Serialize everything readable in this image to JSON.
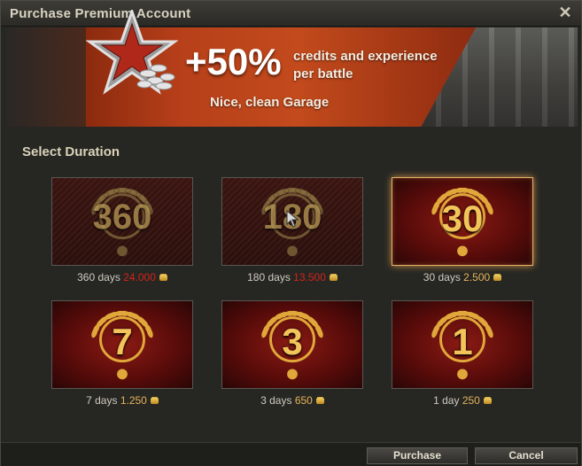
{
  "window": {
    "title": "Purchase Premium Account"
  },
  "banner": {
    "percent": "+50%",
    "bonus_line1": "credits and experience",
    "bonus_line2": "per battle",
    "garage": "Nice, clean Garage"
  },
  "section_title": "Select Duration",
  "durations": [
    {
      "badge": "360",
      "label": "360 days",
      "price": "24.000",
      "price_color": "#d3241a",
      "available": false
    },
    {
      "badge": "180",
      "label": "180 days",
      "price": "13.500",
      "price_color": "#d3241a",
      "available": false
    },
    {
      "badge": "30",
      "label": "30 days",
      "price": "2.500",
      "price_color": "#e6b45a",
      "available": true,
      "selected": true
    },
    {
      "badge": "7",
      "label": "7 days",
      "price": "1.250",
      "price_color": "#e6b45a",
      "available": true
    },
    {
      "badge": "3",
      "label": "3 days",
      "price": "650",
      "price_color": "#e6b45a",
      "available": true
    },
    {
      "badge": "1",
      "label": "1 day",
      "price": "250",
      "price_color": "#e6b45a",
      "available": true
    }
  ],
  "buttons": {
    "purchase": "Purchase",
    "cancel": "Cancel"
  },
  "icons": {
    "close": "close-icon",
    "currency": "gold-coin-icon",
    "star": "premium-star-icon"
  },
  "colors": {
    "accent": "#e6b06a",
    "unaffordable": "#d3241a",
    "gold": "#e6b45a"
  }
}
